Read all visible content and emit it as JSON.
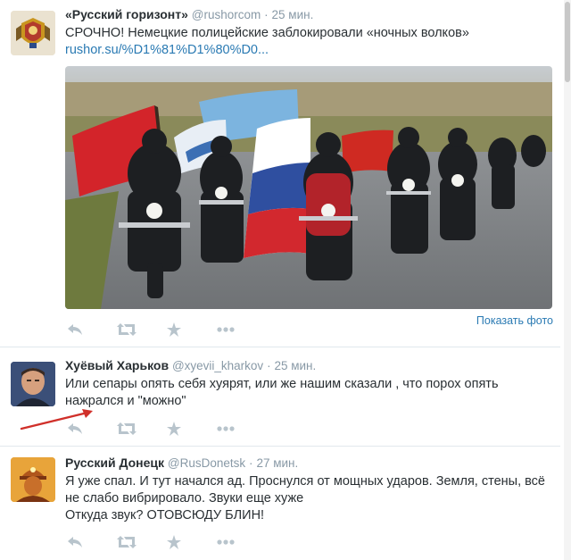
{
  "tweets": [
    {
      "name": "«Русский горизонт»",
      "handle": "@rushorcom",
      "time": "25 мин.",
      "lines": [
        "СРОЧНО! Немецкие полицейские заблокировали «ночных волков»"
      ],
      "link": "rushor.su/%D1%81%D1%80%D0...",
      "show_photo": "Показать фото",
      "media_icon": "bikers-with-flags-photo",
      "avatar_icon": "coat-of-arms-avatar-icon"
    },
    {
      "name": "Хуёвый Харьков",
      "handle": "@xyevii_kharkov",
      "time": "25 мин.",
      "lines": [
        "Или сепары опять себя хуярят, или же нашим сказали , что порох опять",
        "нажрался и \"можно\""
      ],
      "avatar_icon": "man-portrait-avatar-icon"
    },
    {
      "name": "Русский Донецк",
      "handle": "@RusDonetsk",
      "time": "27 мин.",
      "lines": [
        "Я уже спал. И тут начался ад. Проснулся от мощных ударов. Земля, стены, всё",
        "не слабо вибрировало. Звуки еще хуже",
        "Откуда звук? ОТОВСЮДУ БЛИН!"
      ],
      "avatar_icon": "miner-avatar-icon"
    }
  ],
  "colors": {
    "name": "#292f33",
    "meta": "#8899a6",
    "link": "#2a7ab3",
    "action": "#b8c4cc",
    "arrow": "#d0302a"
  },
  "action_icons": [
    "reply-icon",
    "retweet-icon",
    "favorite-icon",
    "more-icon"
  ]
}
